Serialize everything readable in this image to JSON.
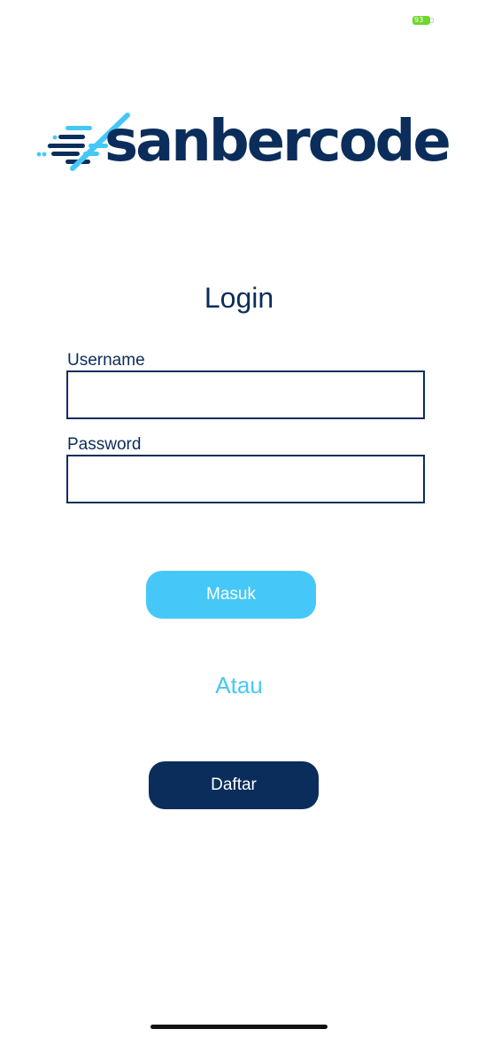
{
  "status_bar": {
    "battery_level": "93",
    "battery_color": "#6fd62b"
  },
  "logo": {
    "wordmark": "sanbercode",
    "icon": "speed-lines-slash-icon",
    "colors": {
      "dark": "#0b2d5b",
      "light": "#45c8f7"
    }
  },
  "login": {
    "title": "Login",
    "username_label": "Username",
    "username_value": "",
    "password_label": "Password",
    "password_value": "",
    "submit_label": "Masuk",
    "separator_text": "Atau",
    "register_label": "Daftar"
  },
  "colors": {
    "primary_dark": "#0b2d5b",
    "accent_light": "#45c8f7",
    "background": "#ffffff"
  }
}
